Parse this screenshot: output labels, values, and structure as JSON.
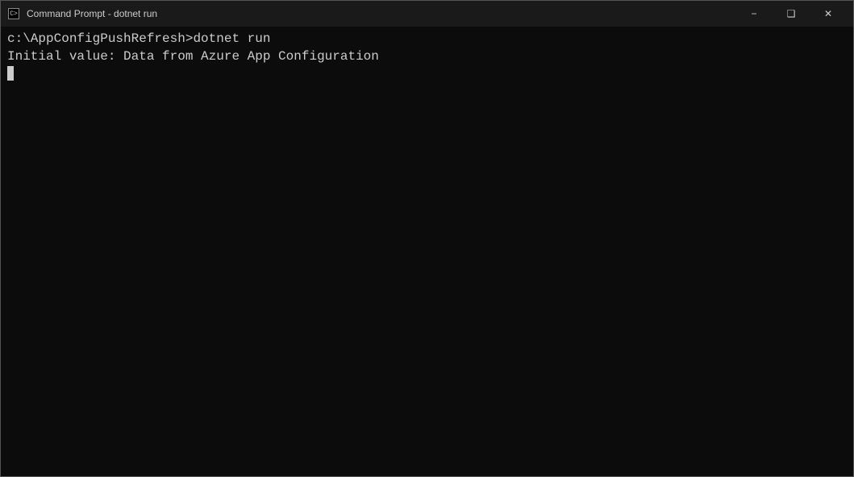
{
  "titleBar": {
    "icon": "C>",
    "title": "Command Prompt - dotnet  run",
    "minimize": "−",
    "maximize": "❑",
    "close": "✕"
  },
  "terminal": {
    "line1": "c:\\AppConfigPushRefresh>dotnet run",
    "line2": "Initial value: Data from Azure App Configuration"
  },
  "statusBar": {
    "text": ""
  }
}
